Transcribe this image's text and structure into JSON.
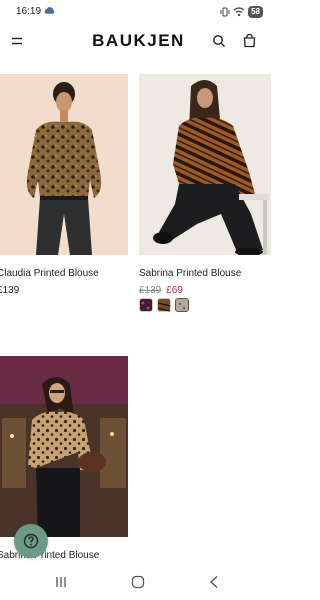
{
  "status_bar": {
    "time": "16:19",
    "battery": "58",
    "notification_icon": "cloud-icon",
    "icons": [
      "vibrate-icon",
      "wifi-icon",
      "battery-icon"
    ]
  },
  "header": {
    "brand": "BAUKJEN",
    "menu_icon": "menu-icon",
    "search_icon": "search-icon",
    "bag_icon": "shopping-bag-icon"
  },
  "products": [
    {
      "name": "Claudia Printed Blouse",
      "price": "£139",
      "image": "leopard print blouse with black jeans"
    },
    {
      "name": "Sabrina Printed Blouse",
      "was_price": "£139",
      "price": "£69",
      "image": "zebra print blouse with black trousers",
      "swatches": [
        {
          "color": "#3a1f33"
        },
        {
          "color": "#7a4a22"
        },
        {
          "color": "#b3a89a"
        }
      ]
    },
    {
      "name": "Sabrina Printed Blouse",
      "image": "leopard print blouse outside cafe"
    }
  ],
  "colors": {
    "sale_price": "#c0254a",
    "help_button": "#6d9a86"
  },
  "help_button": {
    "icon": "question-icon"
  },
  "nav_bar": {
    "icons": [
      "recents-icon",
      "home-icon",
      "back-icon"
    ]
  }
}
